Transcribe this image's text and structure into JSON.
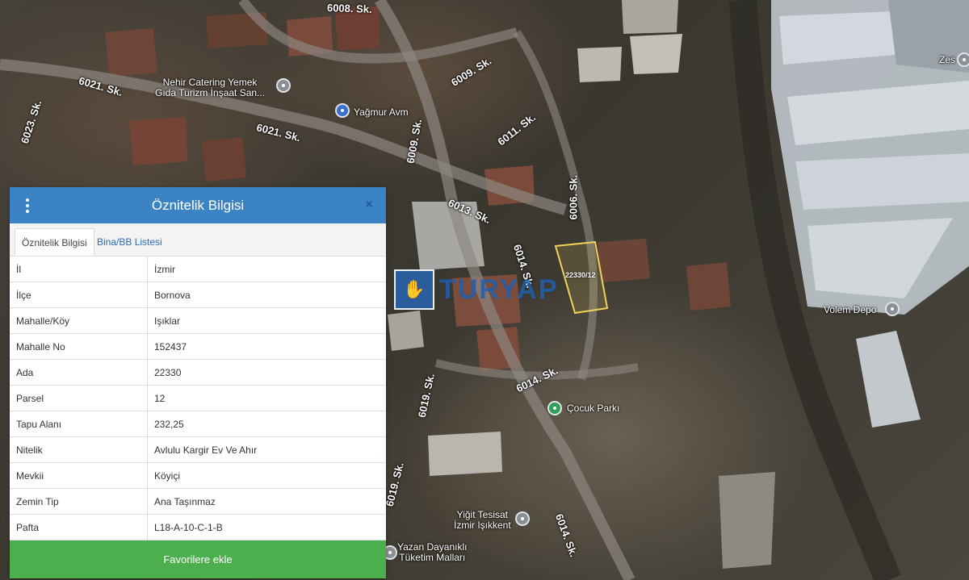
{
  "map": {
    "streets": [
      "6008. Sk.",
      "6021. Sk.",
      "6023. Sk.",
      "6021. Sk.",
      "6009. Sk.",
      "6009. Sk.",
      "6011. Sk.",
      "6006. Sk.",
      "6013. Sk.",
      "6014. Sk.",
      "6014. Sk.",
      "6019. Sk.",
      "6019. Sk.",
      "6014. Sk."
    ],
    "pois": {
      "nehir_catering_line1": "Nehir Catering Yemek",
      "nehir_catering_line2": "Gıda Turizm İnşaat San...",
      "yagmur_avm": "Yağmur Avm",
      "zes": "Zes",
      "volem_depo": "Volem Depo",
      "cocuk_parki": "Çocuk Parkı",
      "yigit_tesisat_line1": "Yiğit Tesisat",
      "yigit_tesisat_line2": "İzmir Işıkkent",
      "yazan_line1": "Yazan Dayanıklı",
      "yazan_line2": "Tüketim Malları"
    },
    "parcel_label": "22330/12",
    "watermark_text": "TURYAP"
  },
  "panel": {
    "title": "Öznitelik Bilgisi",
    "close_glyph": "×",
    "tabs": [
      {
        "label": "Öznitelik Bilgisi"
      },
      {
        "label": "Bina/BB Listesi"
      }
    ],
    "rows": [
      {
        "key": "İl",
        "value": "İzmir"
      },
      {
        "key": "İlçe",
        "value": "Bornova"
      },
      {
        "key": "Mahalle/Köy",
        "value": "Işıklar"
      },
      {
        "key": "Mahalle No",
        "value": "152437"
      },
      {
        "key": "Ada",
        "value": "22330"
      },
      {
        "key": "Parsel",
        "value": "12"
      },
      {
        "key": "Tapu Alanı",
        "value": "232,25"
      },
      {
        "key": "Nitelik",
        "value": "Avlulu Kargir Ev Ve Ahır"
      },
      {
        "key": "Mevkii",
        "value": "Köyiçi"
      },
      {
        "key": "Zemin Tip",
        "value": "Ana Taşınmaz"
      },
      {
        "key": "Pafta",
        "value": "L18-A-10-C-1-B"
      }
    ],
    "favorite_button": "Favorilere ekle"
  },
  "colors": {
    "header": "#3b83c4",
    "button": "#4cae4c",
    "tab_link": "#2a6cb0",
    "parcel_outline": "#f1d35b"
  }
}
